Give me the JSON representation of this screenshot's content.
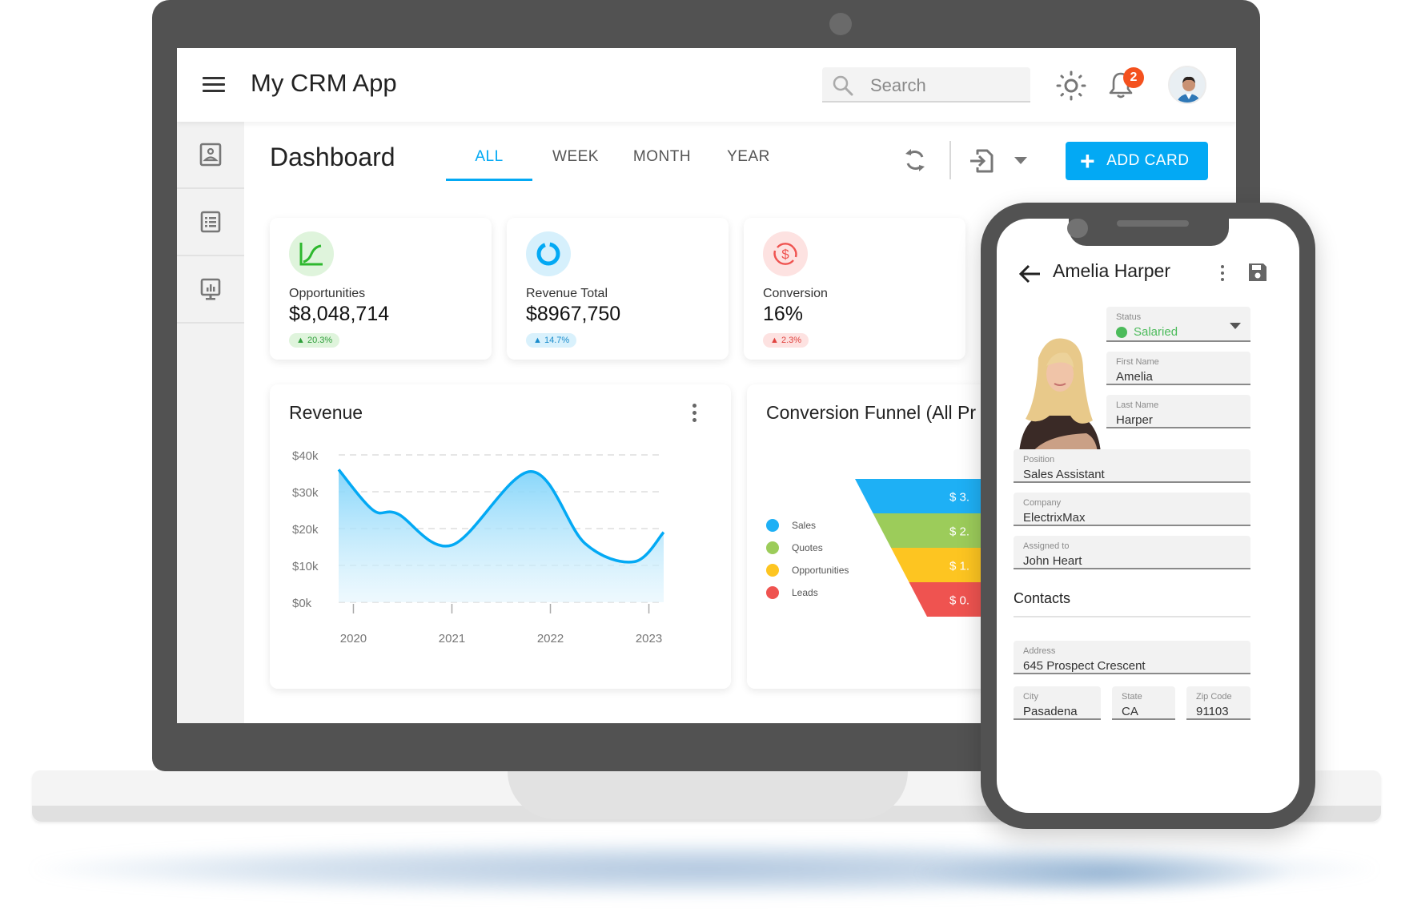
{
  "app": {
    "title": "My CRM App",
    "search_placeholder": "Search",
    "notification_count": "2",
    "icons": {
      "menu": "hamburger-icon",
      "search": "search-icon",
      "theme": "sun-icon",
      "notifications": "bell-icon",
      "user": "avatar"
    }
  },
  "sidebar": {
    "items": [
      {
        "icon": "contact-card-icon",
        "label": "Contacts"
      },
      {
        "icon": "list-icon",
        "label": "Tasks"
      },
      {
        "icon": "presentation-chart-icon",
        "label": "Analytics"
      }
    ]
  },
  "toolbar": {
    "page_title": "Dashboard",
    "tabs": [
      {
        "label": "ALL",
        "active": true
      },
      {
        "label": "WEEK",
        "active": false
      },
      {
        "label": "MONTH",
        "active": false
      },
      {
        "label": "YEAR",
        "active": false
      }
    ],
    "add_card_label": "ADD CARD",
    "icons": {
      "refresh": "refresh-icon",
      "export": "export-icon",
      "dropdown": "caret-down-icon"
    }
  },
  "kpis": [
    {
      "label": "Opportunities",
      "value": "$8,048,714",
      "change": "20.3%",
      "direction": "up",
      "icon": "trend-chart-icon",
      "color": "#2eb82e",
      "bg": "#dff4dc",
      "badge_bg": "#dff4dc",
      "badge_fg": "#2e9e3a"
    },
    {
      "label": "Revenue Total",
      "value": "$8967,750",
      "change": "14.7%",
      "direction": "up",
      "icon": "donut-icon",
      "color": "#03a9f4",
      "bg": "#d6f0fc",
      "badge_bg": "#d9f1fc",
      "badge_fg": "#1a8ccc"
    },
    {
      "label": "Conversion",
      "value": "16%",
      "change": "2.3%",
      "direction": "up",
      "icon": "dollar-exchange-icon",
      "color": "#ef5350",
      "bg": "#fde2e1",
      "badge_bg": "#fde2e1",
      "badge_fg": "#e0433f"
    }
  ],
  "revenue_card": {
    "title": "Revenue",
    "chart_data": {
      "type": "area",
      "title": "Revenue",
      "x": [
        2019.85,
        2020.2,
        2020.45,
        2021.0,
        2021.8,
        2022.35,
        2022.85,
        2023.15
      ],
      "y": [
        36,
        25,
        24,
        15.5,
        35.5,
        16,
        11,
        19
      ],
      "xticks": [
        "2020",
        "2021",
        "2022",
        "2023"
      ],
      "xtick_values": [
        2020,
        2021,
        2022,
        2023
      ],
      "yticks": [
        "$0k",
        "$10k",
        "$20k",
        "$30k",
        "$40k"
      ],
      "ylim": [
        0,
        40
      ],
      "xlim": [
        2019.85,
        2023.15
      ],
      "grid": true,
      "line_color": "#03a9f4"
    }
  },
  "funnel_card": {
    "title": "Conversion Funnel (All Pr",
    "chart_data": {
      "type": "funnel",
      "title": "Conversion Funnel (All Pr",
      "legend_position": "left",
      "stages": [
        {
          "name": "Sales",
          "label": "$ 3.",
          "color": "#1eb0f5"
        },
        {
          "name": "Quotes",
          "label": "$ 2.",
          "color": "#9ccc5a"
        },
        {
          "name": "Opportunities",
          "label": "$ 1.",
          "color": "#fdc521"
        },
        {
          "name": "Leads",
          "label": "$ 0.",
          "color": "#ef5350"
        }
      ]
    }
  },
  "contact": {
    "name": "Amelia Harper",
    "icons": {
      "back": "arrow-back-icon",
      "more": "more-vert-icon",
      "save": "save-icon"
    },
    "status": {
      "label": "Status",
      "value": "Salaried"
    },
    "fields": [
      {
        "label": "First Name",
        "value": "Amelia"
      },
      {
        "label": "Last Name",
        "value": "Harper"
      },
      {
        "label": "Position",
        "value": "Sales Assistant"
      },
      {
        "label": "Company",
        "value": "ElectrixMax"
      },
      {
        "label": "Assigned to",
        "value": "John Heart"
      }
    ],
    "contacts_section": "Contacts",
    "address": {
      "label": "Address",
      "value": "645 Prospect Crescent"
    },
    "city": {
      "label": "City",
      "value": "Pasadena"
    },
    "state": {
      "label": "State",
      "value": "CA"
    },
    "zip": {
      "label": "Zip Code",
      "value": "91103"
    }
  }
}
